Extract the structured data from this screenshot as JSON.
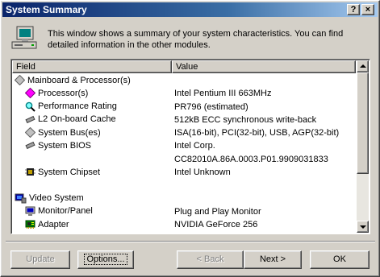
{
  "window": {
    "title": "System Summary",
    "help_label": "?",
    "close_label": "×"
  },
  "intro": {
    "icon": "computer-icon",
    "text": "This window shows a summary of your system characteristics. You can find detailed information in the other modules."
  },
  "list": {
    "columns": [
      "Field",
      "Value"
    ],
    "rows": [
      {
        "icon": "diamond-gray-icon",
        "indent": 0,
        "field": "Mainboard & Processor(s)",
        "value": ""
      },
      {
        "icon": "diamond-magenta-icon",
        "indent": 1,
        "field": "Processor(s)",
        "value": "Intel Pentium III 663MHz"
      },
      {
        "icon": "magnifier-icon",
        "indent": 1,
        "field": "Performance Rating",
        "value": "PR796  (estimated)"
      },
      {
        "icon": "memory-chip-icon",
        "indent": 1,
        "field": "L2 On-board Cache",
        "value": "512kB ECC synchronous write-back"
      },
      {
        "icon": "diamond-gray-icon",
        "indent": 1,
        "field": "System Bus(es)",
        "value": "ISA(16-bit), PCI(32-bit), USB, AGP(32-bit)"
      },
      {
        "icon": "memory-chip-icon",
        "indent": 1,
        "field": "System BIOS",
        "value": "Intel Corp."
      },
      {
        "icon": "",
        "indent": 1,
        "field": "",
        "value": "CC82010A.86A.0003.P01.9909031833"
      },
      {
        "icon": "chip-icon",
        "indent": 1,
        "field": "System Chipset",
        "value": "Intel Unknown"
      },
      {
        "icon": "",
        "indent": 0,
        "field": "",
        "value": ""
      },
      {
        "icon": "video-system-icon",
        "indent": 0,
        "field": "Video System",
        "value": ""
      },
      {
        "icon": "monitor-icon",
        "indent": 1,
        "field": "Monitor/Panel",
        "value": "Plug and Play Monitor"
      },
      {
        "icon": "adapter-icon",
        "indent": 1,
        "field": "Adapter",
        "value": "NVIDIA GeForce 256"
      }
    ]
  },
  "buttons": {
    "update": "Update",
    "options": "Options...",
    "back": "< Back",
    "next": "Next >",
    "ok": "OK"
  },
  "colors": {
    "title_start": "#0a246a",
    "title_end": "#a6caf0",
    "face": "#d4d0c8"
  }
}
